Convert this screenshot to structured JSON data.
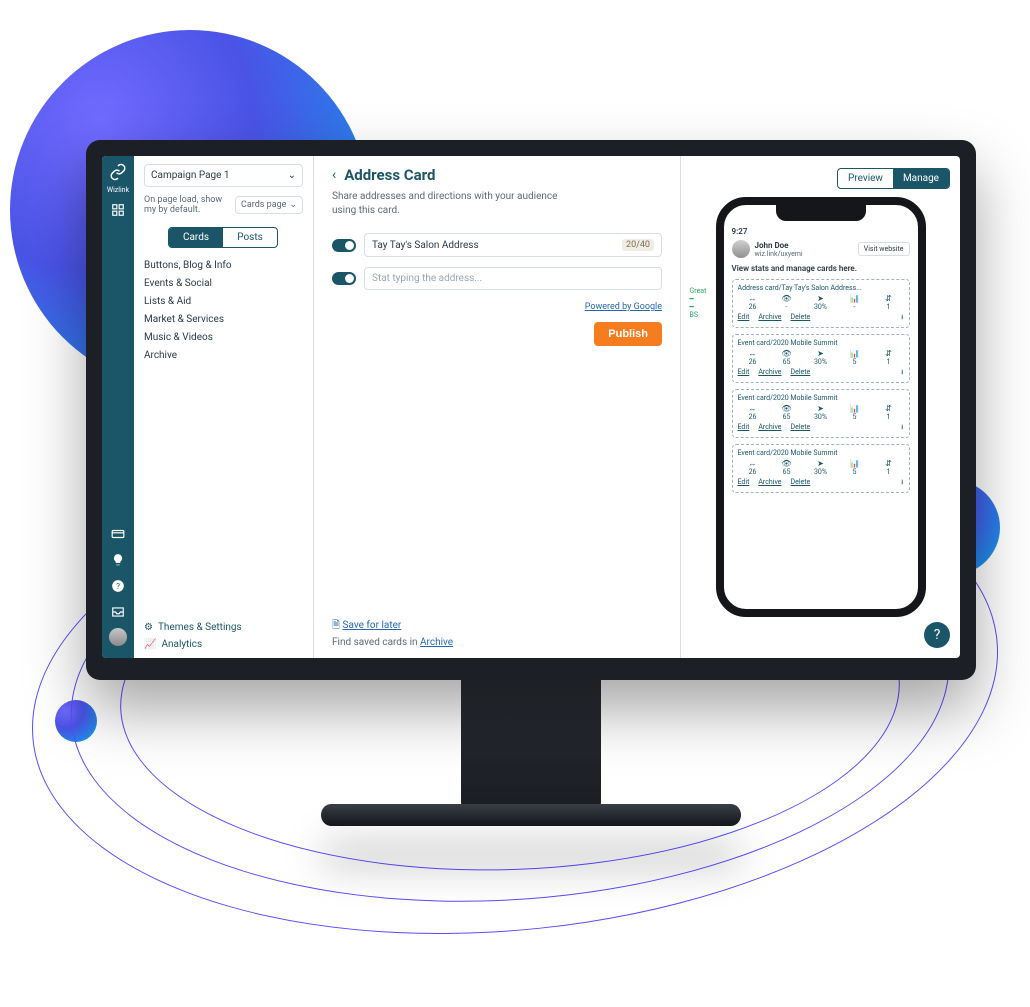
{
  "colors": {
    "teal": "#1a5568",
    "orange": "#f57c1f",
    "link": "#2468b2"
  },
  "brand": "Wizlink",
  "nav_icons": [
    "grid",
    "card",
    "idea",
    "help",
    "inbox"
  ],
  "sidebar": {
    "page_select": "Campaign Page 1",
    "load_text": "On page load, show my by default.",
    "load_select": "Cards page",
    "tabs": [
      "Cards",
      "Posts"
    ],
    "active_tab": 0,
    "categories": [
      "Buttons, Blog & Info",
      "Events & Social",
      "Lists & Aid",
      "Market & Services",
      "Music & Videos",
      "Archive"
    ],
    "bottom": {
      "themes": "Themes & Settings",
      "analytics": "Analytics"
    }
  },
  "editor": {
    "title": "Address Card",
    "desc": "Share addresses and directions with your audience using this card.",
    "field1": {
      "value": "Tay Tay's Salon Address",
      "count": "20/40"
    },
    "field2": {
      "placeholder": "Stat typing the address..."
    },
    "powered": "Powered by Google",
    "publish": "Publish",
    "save": "Save for later",
    "save_sub_prefix": "Find saved cards in ",
    "save_sub_link": "Archive"
  },
  "preview": {
    "tabs": [
      "Preview",
      "Manage"
    ],
    "active_tab": 1,
    "time": "9:27",
    "profile": {
      "name": "John Doe",
      "handle": "wiz.link/uxyemi",
      "visit": "Visit website"
    },
    "helper": "View stats and manage cards here.",
    "cards": [
      {
        "title": "Address card/Tay Tay's Salon Address...",
        "stats": [
          "26",
          "-",
          "30%",
          "-",
          "1"
        ]
      },
      {
        "title": "Event card/2020 Mobile Summit",
        "stats": [
          "26",
          "65",
          "30%",
          "5",
          "1"
        ]
      },
      {
        "title": "Event card/2020 Mobile Summit",
        "stats": [
          "26",
          "65",
          "30%",
          "5",
          "1"
        ]
      },
      {
        "title": "Event card/2020 Mobile Summit",
        "stats": [
          "26",
          "65",
          "30%",
          "5",
          "1"
        ]
      }
    ],
    "card_actions": [
      "Edit",
      "Archive",
      "Delete"
    ],
    "side_label": "Great\nBS"
  }
}
